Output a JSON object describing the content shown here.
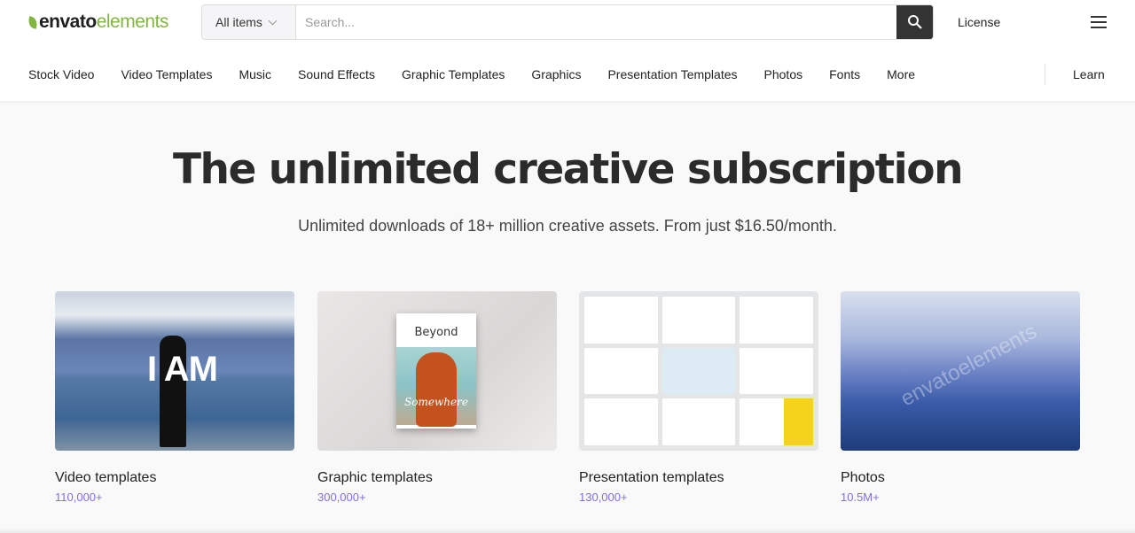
{
  "header": {
    "logo_main": "envato",
    "logo_accent": "elements",
    "category_select": "All items",
    "search_placeholder": "Search...",
    "license": "License"
  },
  "nav": {
    "items": [
      "Stock Video",
      "Video Templates",
      "Music",
      "Sound Effects",
      "Graphic Templates",
      "Graphics",
      "Presentation Templates",
      "Photos",
      "Fonts",
      "More"
    ],
    "learn": "Learn"
  },
  "hero": {
    "title": "The unlimited creative subscription",
    "subtitle": "Unlimited downloads of 18+ million creative assets. From just $16.50/month."
  },
  "cards": [
    {
      "title": "Video templates",
      "count": "110,000+",
      "image_text": "I AM"
    },
    {
      "title": "Graphic templates",
      "count": "300,000+",
      "image_text": "Beyond",
      "image_text2": "Somewhere"
    },
    {
      "title": "Presentation templates",
      "count": "130,000+"
    },
    {
      "title": "Photos",
      "count": "10.5M+",
      "image_text": "envatoelements"
    }
  ],
  "colors": {
    "brand": "#82b541",
    "count": "#8170e0"
  }
}
